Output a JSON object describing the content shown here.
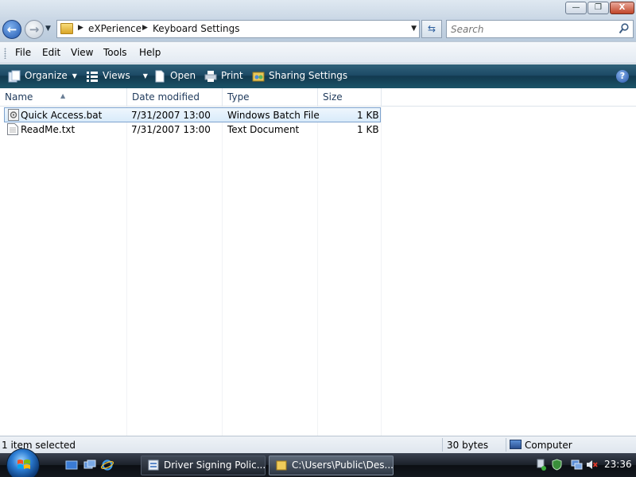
{
  "window": {
    "caption_buttons": {
      "minimize": "—",
      "maximize": "❐",
      "close": "X"
    }
  },
  "navigation": {
    "back_icon": "back-arrow-icon",
    "forward_icon": "forward-arrow-icon",
    "breadcrumbs": [
      "eXPerience",
      "Keyboard Settings"
    ],
    "search_placeholder": "Search"
  },
  "menu": {
    "items": [
      "File",
      "Edit",
      "View",
      "Tools",
      "Help"
    ]
  },
  "toolbar": {
    "organize": "Organize",
    "views": "Views",
    "open": "Open",
    "print": "Print",
    "sharing": "Sharing Settings",
    "help": "?"
  },
  "columns": {
    "name": "Name",
    "date_modified": "Date modified",
    "type": "Type",
    "size": "Size"
  },
  "files": [
    {
      "name": "Quick Access.bat",
      "date": "7/31/2007 13:00",
      "type": "Windows Batch File",
      "size": "1 KB",
      "selected": true,
      "icon": "batch-file-icon"
    },
    {
      "name": "ReadMe.txt",
      "date": "7/31/2007 13:00",
      "type": "Text Document",
      "size": "1 KB",
      "selected": false,
      "icon": "text-file-icon"
    }
  ],
  "status": {
    "selection": "1 item selected",
    "size": "30 bytes",
    "location": "Computer"
  },
  "taskbar": {
    "tasks": [
      {
        "label": "Driver Signing Polic...",
        "active": false
      },
      {
        "label": "C:\\Users\\Public\\Des...",
        "active": true
      }
    ],
    "clock": "23:36"
  },
  "colors": {
    "command_bar": "#1d4a66",
    "selection_border": "#7da2ce",
    "header_text": "#1e395b"
  }
}
